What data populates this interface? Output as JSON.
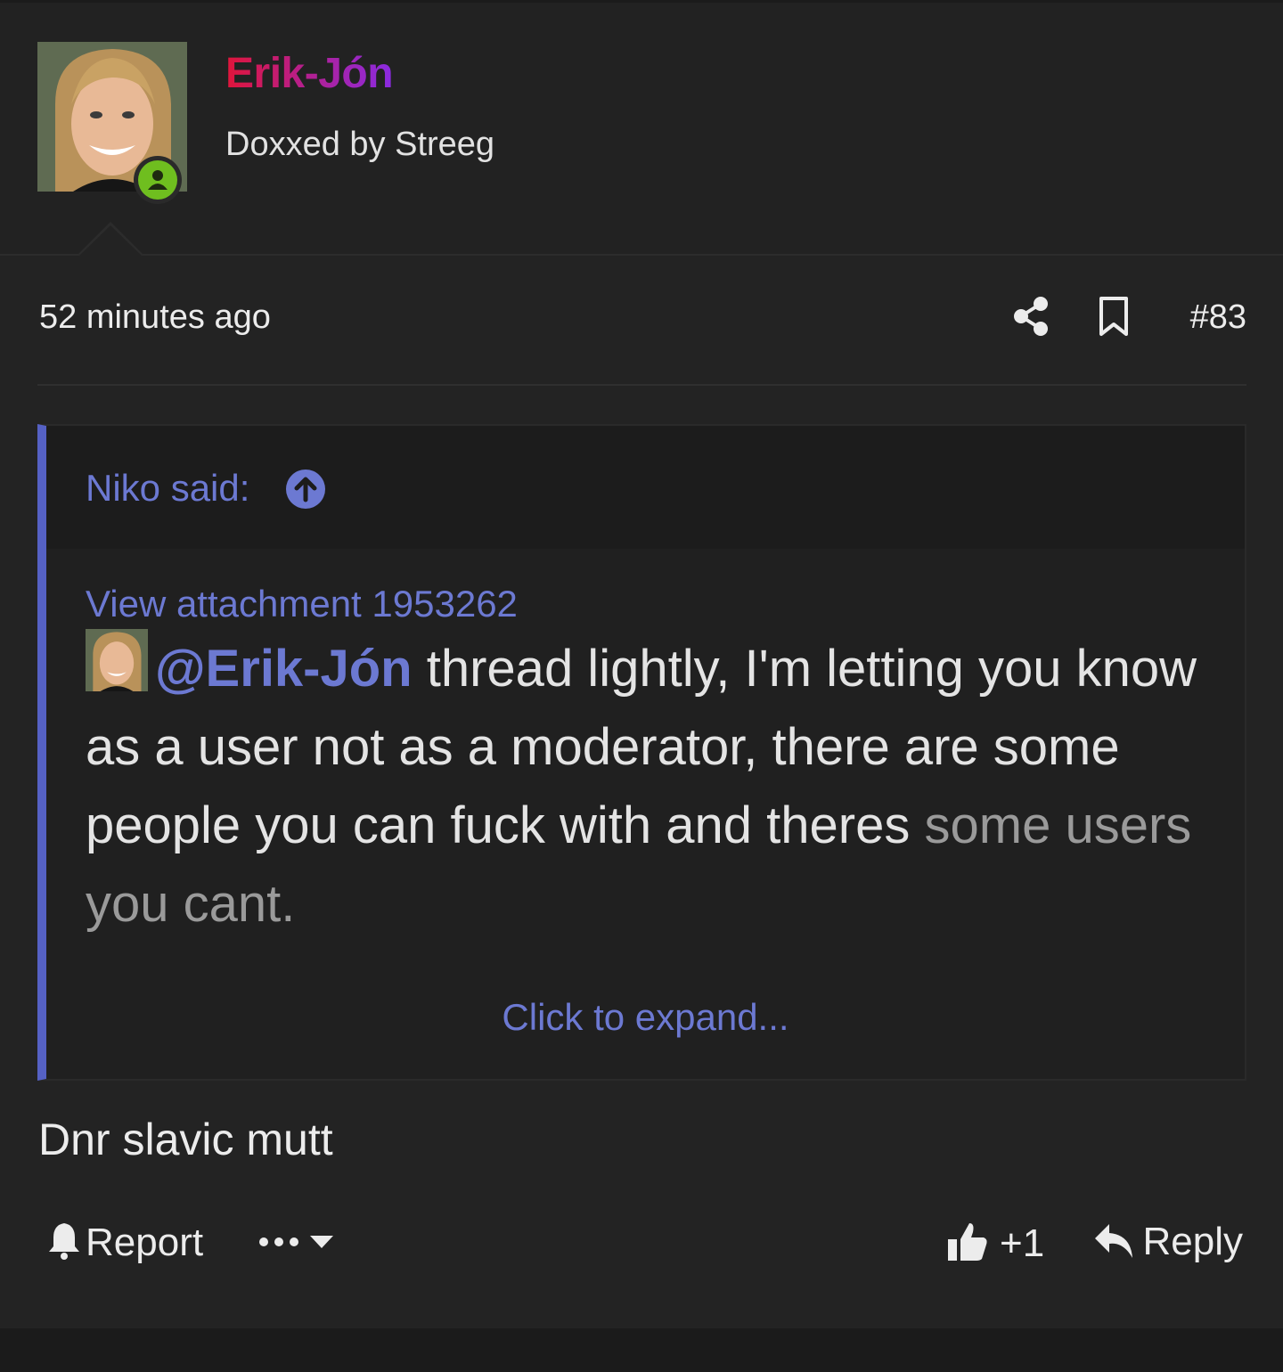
{
  "post": {
    "username": "Erik-Jón",
    "user_title": "Doxxed by Streeg",
    "timestamp": "52 minutes ago",
    "post_number": "#83",
    "icons": {
      "share": "share-icon",
      "bookmark": "bookmark-icon",
      "online": "online-status-icon"
    },
    "colors": {
      "accent": "#6c79d2",
      "quote_bar": "#5561c4",
      "online": "#6fbe1f",
      "username_start": "#e0153a",
      "username_end": "#8a2be2"
    }
  },
  "quote": {
    "author": "Niko said:",
    "attachment_link": "View attachment 1953262",
    "mention": "@Erik-Jón",
    "text_main": " thread lightly, I'm letting you know as a user not as a moderator, there are some people you can fuck with and theres",
    "text_faded": "some users you cant.",
    "expand": "Click to expand..."
  },
  "message": "Dnr slavic mutt",
  "actions": {
    "report": "Report",
    "reaction_count": "+1",
    "reply": "Reply"
  }
}
